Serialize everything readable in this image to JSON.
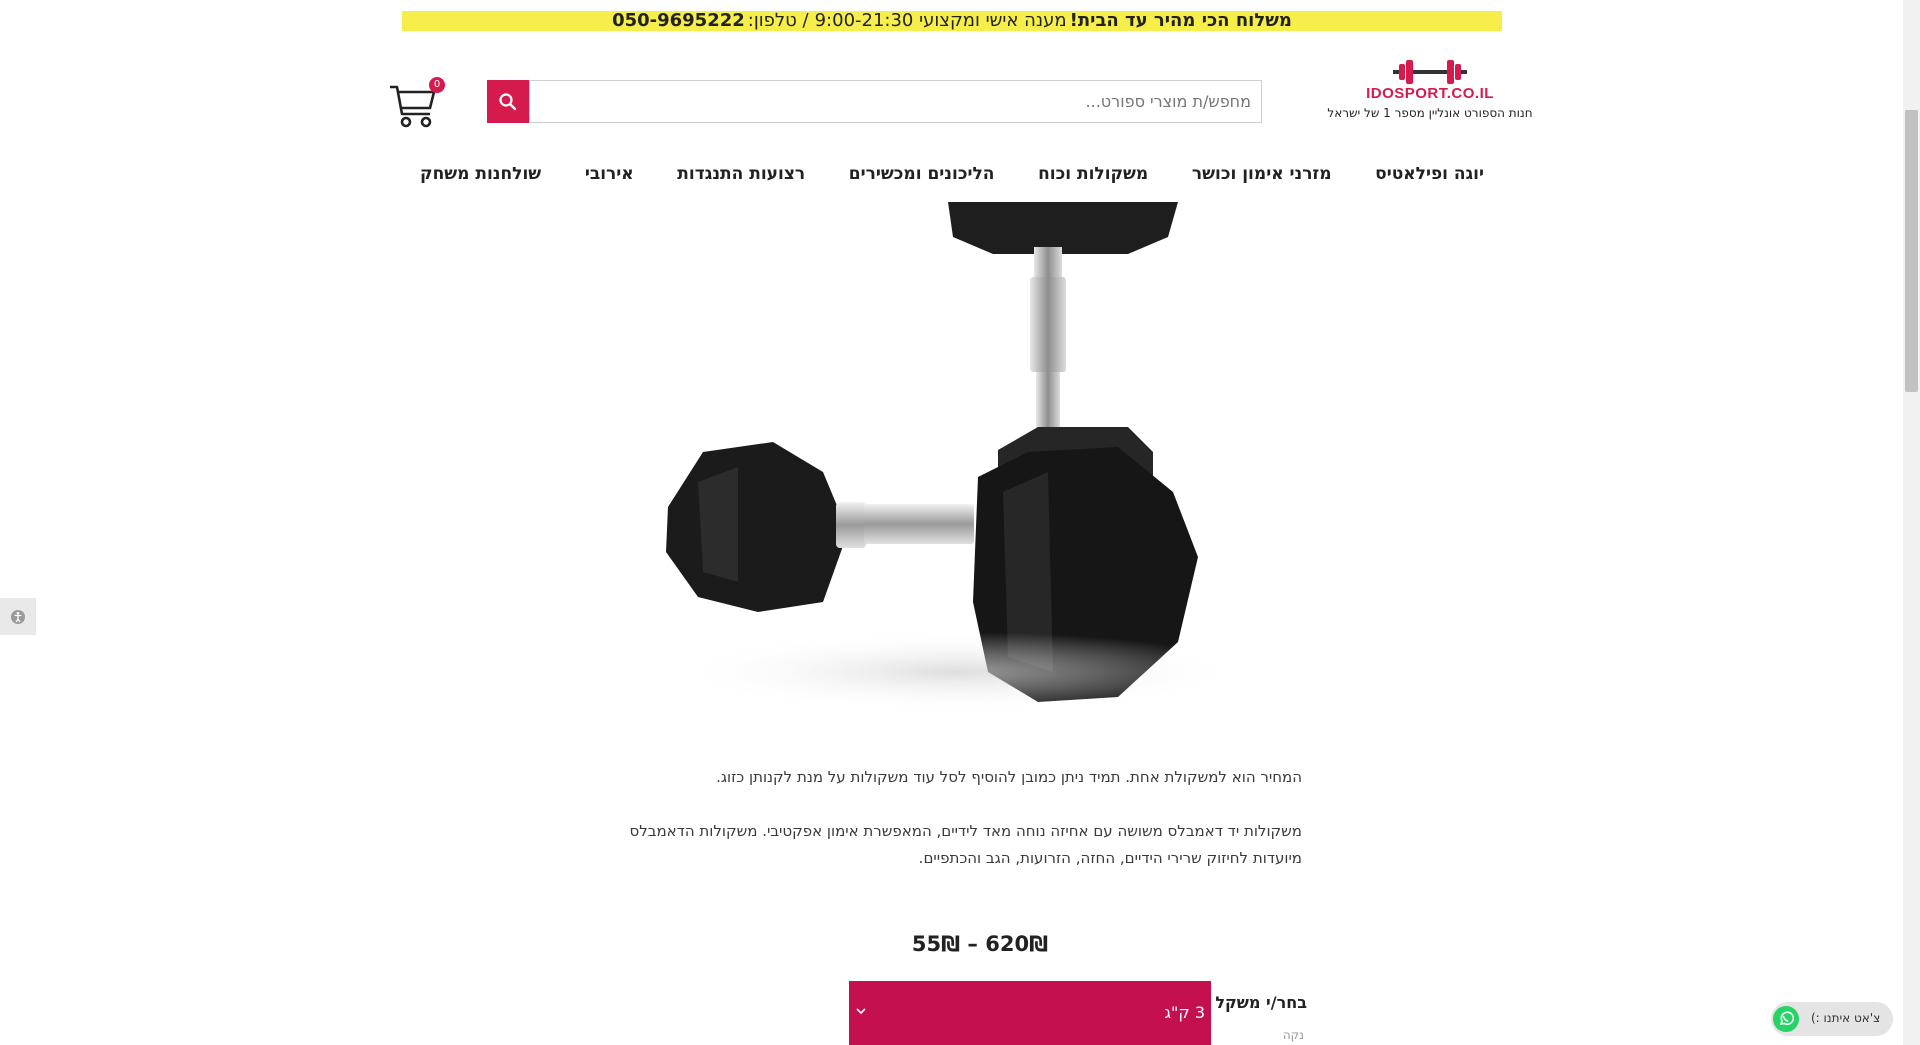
{
  "promo": {
    "phone": "050-9695222",
    "phone_label": "/ טלפון:",
    "service_text": "מענה אישי ומקצועי 9:00-21:30",
    "headline": "משלוח הכי מהיר עד הבית!"
  },
  "logo": {
    "name": "IDOSPORT.CO.IL",
    "tagline": "חנות הספורט אונליין מספר 1 של ישראל"
  },
  "search": {
    "placeholder": "מחפש/ת מוצרי ספורט..."
  },
  "cart": {
    "count": "0"
  },
  "nav": {
    "items": [
      {
        "label": "יוגה ופילאטיס"
      },
      {
        "label": "מזרני אימון וכושר"
      },
      {
        "label": "משקולות וכוח"
      },
      {
        "label": "הליכונים ומכשירים"
      },
      {
        "label": "רצועות התנגדות"
      },
      {
        "label": "אירובי"
      },
      {
        "label": "שולחנות משחק"
      }
    ]
  },
  "product": {
    "image_icon": "hex-dumbbells-image",
    "description_1": "המחיר הוא למשקולת אחת. תמיד ניתן כמובן להוסיף לסל עוד משקולות על מנת לקנותן כזוג.",
    "description_2": "משקולות יד דאמבלס משושה עם אחיזה נוחה מאד לידיים, המאפשרת אימון אפקטיבי. משקולות הדאמבלס מיועדות לחיזוק שרירי הידיים, החזה, הזרועות, הגב והכתפיים.",
    "price_range": "55₪ – 620₪",
    "option_label": "בחר/י משקל",
    "option_value": "3 ק\"ג",
    "clear_label": "נקה"
  },
  "whatsapp": {
    "text": "צ'אט איתנו :)"
  },
  "colors": {
    "accent": "#d51a4e",
    "promo_bg": "#f6ee4a",
    "select_bg": "#c4104f"
  }
}
